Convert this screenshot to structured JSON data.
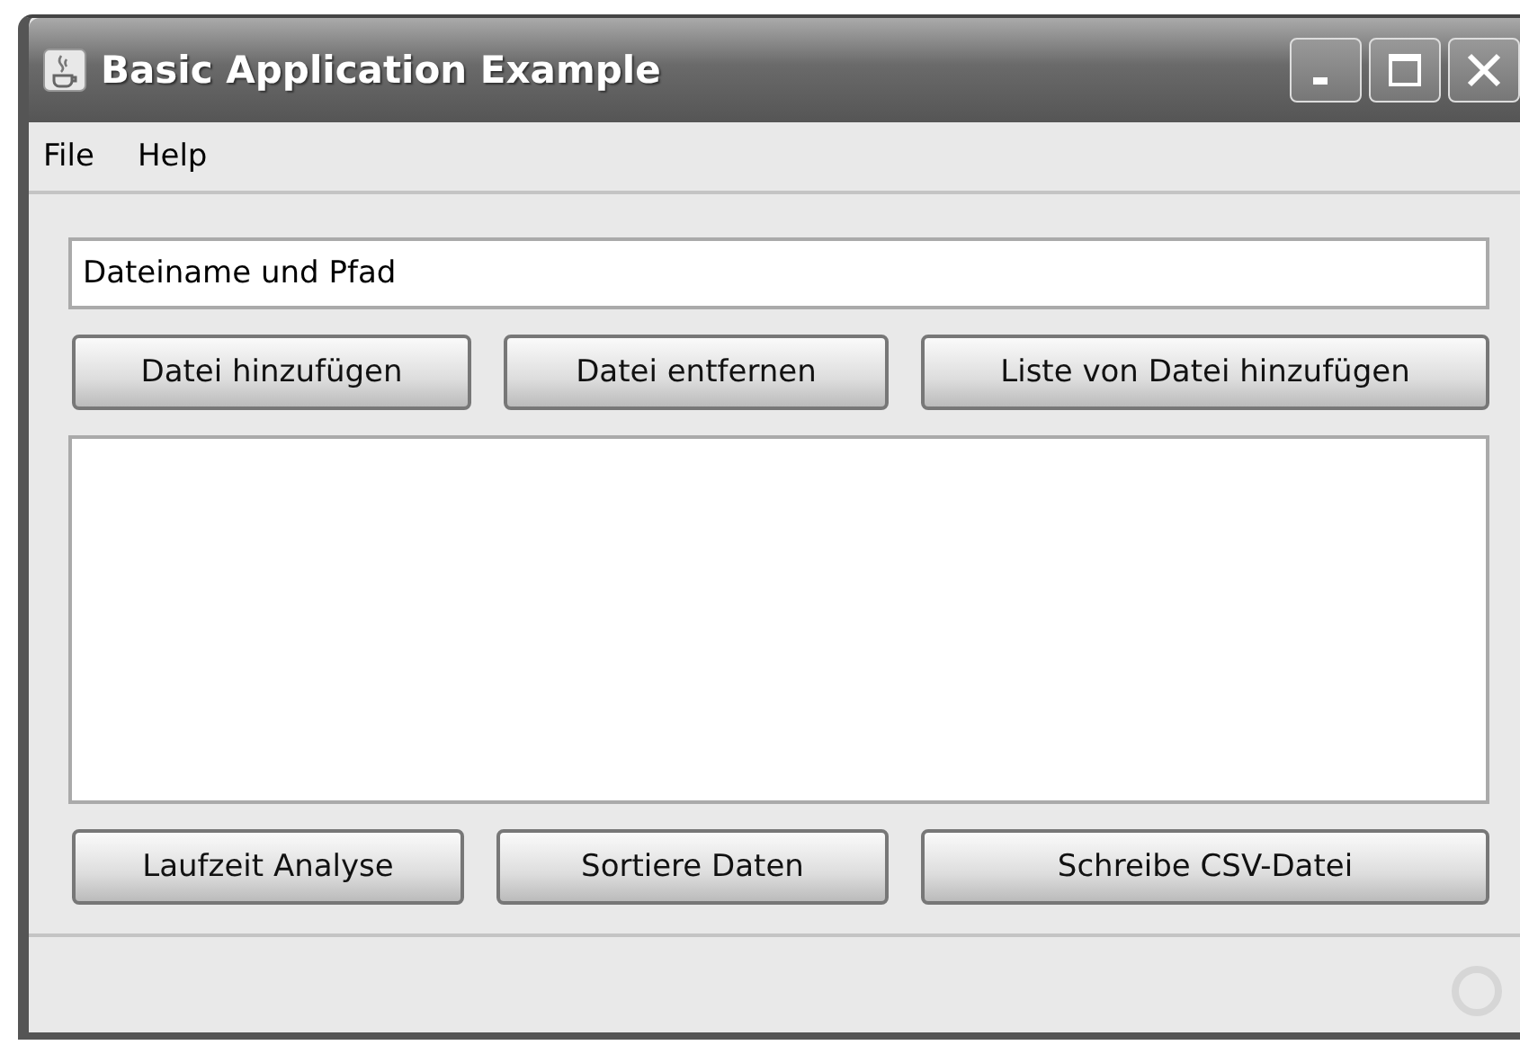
{
  "window": {
    "title": "Basic Application Example"
  },
  "menu": [
    "File",
    "Help"
  ],
  "path_field": {
    "value": "Dateiname und Pfad"
  },
  "top_buttons": [
    "Datei hinzufügen",
    "Datei entfernen",
    "Liste von Datei hinzufügen"
  ],
  "bottom_buttons": [
    "Laufzeit Analyse",
    "Sortiere Daten",
    "Schreibe CSV-Datei"
  ]
}
